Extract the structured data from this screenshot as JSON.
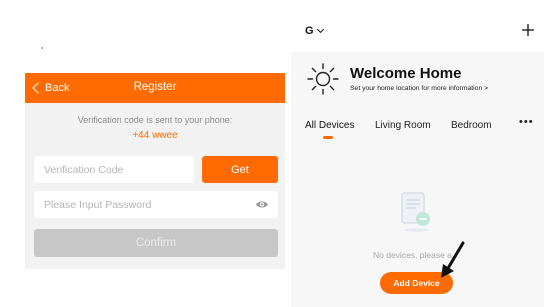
{
  "register": {
    "back_label": "Back",
    "title": "Register",
    "verify_text": "Verification code is sent to your phone:",
    "phone": "+44 wwee",
    "code_placeholder": "Verification Code",
    "get_label": "Get",
    "password_placeholder": "Please Input Password",
    "confirm_label": "Confirm"
  },
  "home": {
    "selector": "G",
    "welcome_title": "Welcome Home",
    "welcome_subtitle": "Set your home location for more information >",
    "tabs": [
      {
        "label": "All Devices",
        "active": true
      },
      {
        "label": "Living Room",
        "active": false
      },
      {
        "label": "Bedroom",
        "active": false
      }
    ],
    "more_label": "•••",
    "empty_text": "No devices, please a",
    "add_device_label": "Add Device"
  },
  "colors": {
    "accent": "#ff6b00",
    "panel_bg": "#f2f2f2",
    "disabled": "#c7c7c7"
  },
  "icons": [
    "chevron-left-icon",
    "eye-icon",
    "chevron-down-icon",
    "plus-icon",
    "sun-icon",
    "document-icon",
    "arrow-icon"
  ]
}
